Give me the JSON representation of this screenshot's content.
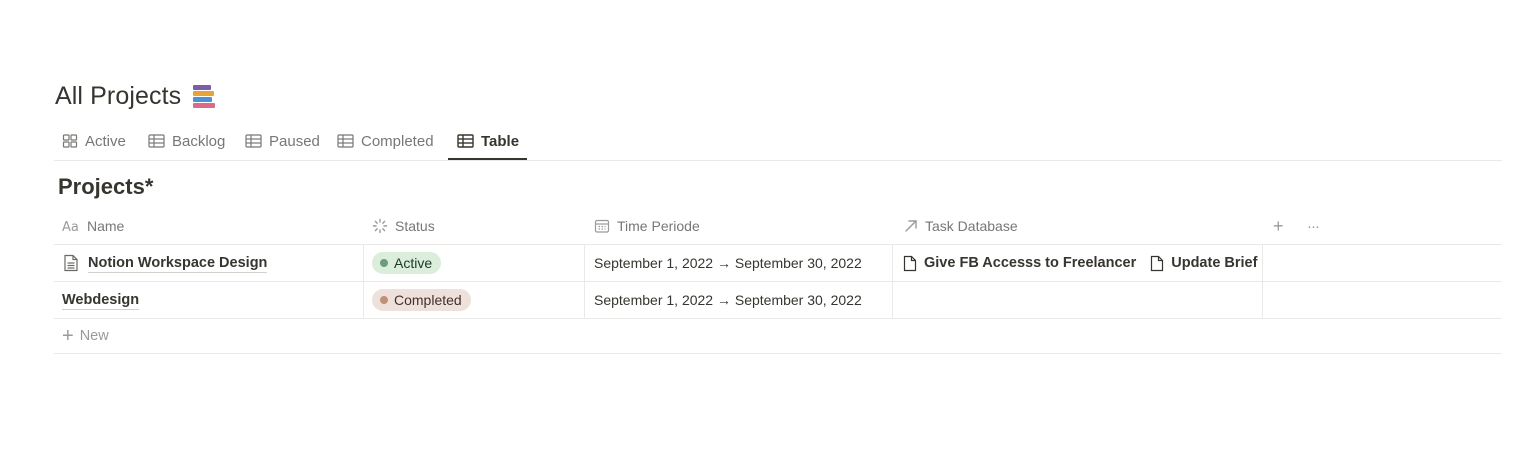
{
  "page": {
    "title": "All Projects",
    "icon": "books-emoji"
  },
  "tabs": [
    {
      "label": "Active",
      "icon": "board-icon",
      "active": false
    },
    {
      "label": "Backlog",
      "icon": "table-icon",
      "active": false
    },
    {
      "label": "Paused",
      "icon": "table-icon",
      "active": false
    },
    {
      "label": "Completed",
      "icon": "table-icon",
      "active": false
    },
    {
      "label": "Table",
      "icon": "table-icon",
      "active": true
    }
  ],
  "database": {
    "title": "Projects*",
    "columns": [
      {
        "label": "Name",
        "icon": "text-property-icon"
      },
      {
        "label": "Status",
        "icon": "status-icon"
      },
      {
        "label": "Time Periode",
        "icon": "calendar-icon"
      },
      {
        "label": "Task Database",
        "icon": "relation-arrow-icon"
      }
    ],
    "rows": [
      {
        "name": "Notion Workspace Design",
        "has_page_icon": true,
        "status": {
          "label": "Active",
          "bg": "#dbeddb",
          "dot": "#6c9b7d"
        },
        "time_period": "September 1, 2022 → September 30, 2022",
        "tasks": [
          "Give FB Accesss to Freelancer",
          "Update Brief"
        ]
      },
      {
        "name": "Webdesign",
        "has_page_icon": false,
        "status": {
          "label": "Completed",
          "bg": "#eee0da",
          "dot": "#c08f78"
        },
        "time_period": "September 1, 2022 → September 30, 2022",
        "tasks": []
      }
    ],
    "new_label": "New",
    "add_column_symbol": "+",
    "more_symbol": "···"
  }
}
